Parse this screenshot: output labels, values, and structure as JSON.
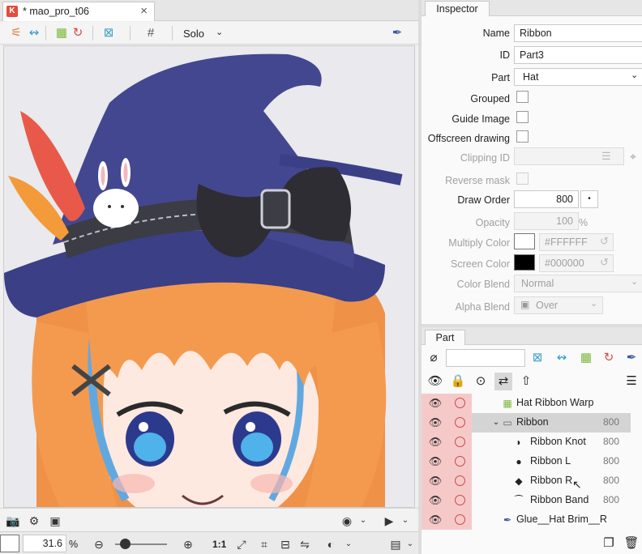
{
  "document_tab": {
    "title": "* mao_pro_t06",
    "close": "×"
  },
  "view_toolbar": {
    "solo_label": "Solo"
  },
  "status_bar": {
    "zoom_value": "31.6",
    "zoom_unit": "%",
    "ratio_label": "1:1"
  },
  "inspector": {
    "tab": "Inspector",
    "name_label": "Name",
    "name_value": "Ribbon",
    "id_label": "ID",
    "id_value": "Part3",
    "part_label": "Part",
    "part_value": "Hat",
    "grouped_label": "Grouped",
    "guide_image_label": "Guide Image",
    "offscreen_label": "Offscreen drawing",
    "clipping_label": "Clipping ID",
    "reverse_mask_label": "Reverse mask",
    "draw_order_label": "Draw Order",
    "draw_order_value": "800",
    "opacity_label": "Opacity",
    "opacity_value": "100",
    "opacity_unit": "%",
    "multiply_label": "Multiply Color",
    "multiply_value": "#FFFFFF",
    "screen_label": "Screen Color",
    "screen_value": "#000000",
    "color_blend_label": "Color Blend",
    "color_blend_value": "Normal",
    "alpha_blend_label": "Alpha Blend",
    "alpha_blend_value": "Over"
  },
  "part_panel": {
    "tab": "Part",
    "search_placeholder": "",
    "rows": [
      {
        "name": "Hat Ribbon Warp",
        "order": ""
      },
      {
        "name": "Ribbon",
        "order": "800"
      },
      {
        "name": "Ribbon Knot",
        "order": "800"
      },
      {
        "name": "Ribbon L",
        "order": "800"
      },
      {
        "name": "Ribbon R",
        "order": "800"
      },
      {
        "name": "Ribbon Band",
        "order": "800"
      },
      {
        "name": "Glue__Hat Brim__R",
        "order": ""
      }
    ]
  },
  "colors": {
    "accent_red": "#e64b3c",
    "visibility_bg": "#f6c9c9",
    "selected_row": "#d4d4d4",
    "hat": "#3a3f86",
    "hair": "#f49a4e"
  }
}
